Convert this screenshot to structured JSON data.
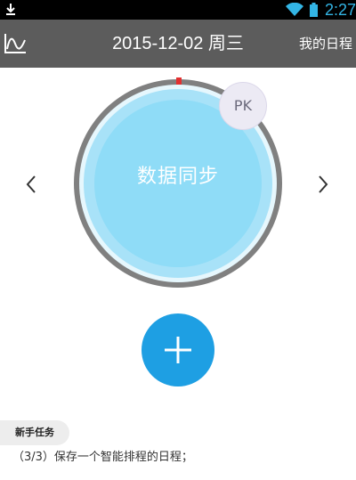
{
  "status_bar": {
    "time": "2:27",
    "accent_color": "#33b5e5"
  },
  "header": {
    "date": "2015-12-02 周三",
    "schedule_link": "我的日程",
    "background": "#5c5c5c"
  },
  "sync": {
    "label": "数据同步"
  },
  "pk": {
    "label": "PK"
  },
  "task": {
    "badge": "新手任务",
    "text": "（3/3）保存一个智能排程的日程；"
  },
  "icons": {
    "status_left": "download-icon",
    "wifi": "wifi-icon",
    "battery": "battery-icon",
    "chart": "line-chart-icon",
    "prev": "chevron-left-icon",
    "next": "chevron-right-icon",
    "add": "plus-icon"
  },
  "colors": {
    "ring_fill": "#8fdcf7",
    "ring_outer": "#808080",
    "marker": "#e33030",
    "add_button": "#1e9fe3"
  }
}
